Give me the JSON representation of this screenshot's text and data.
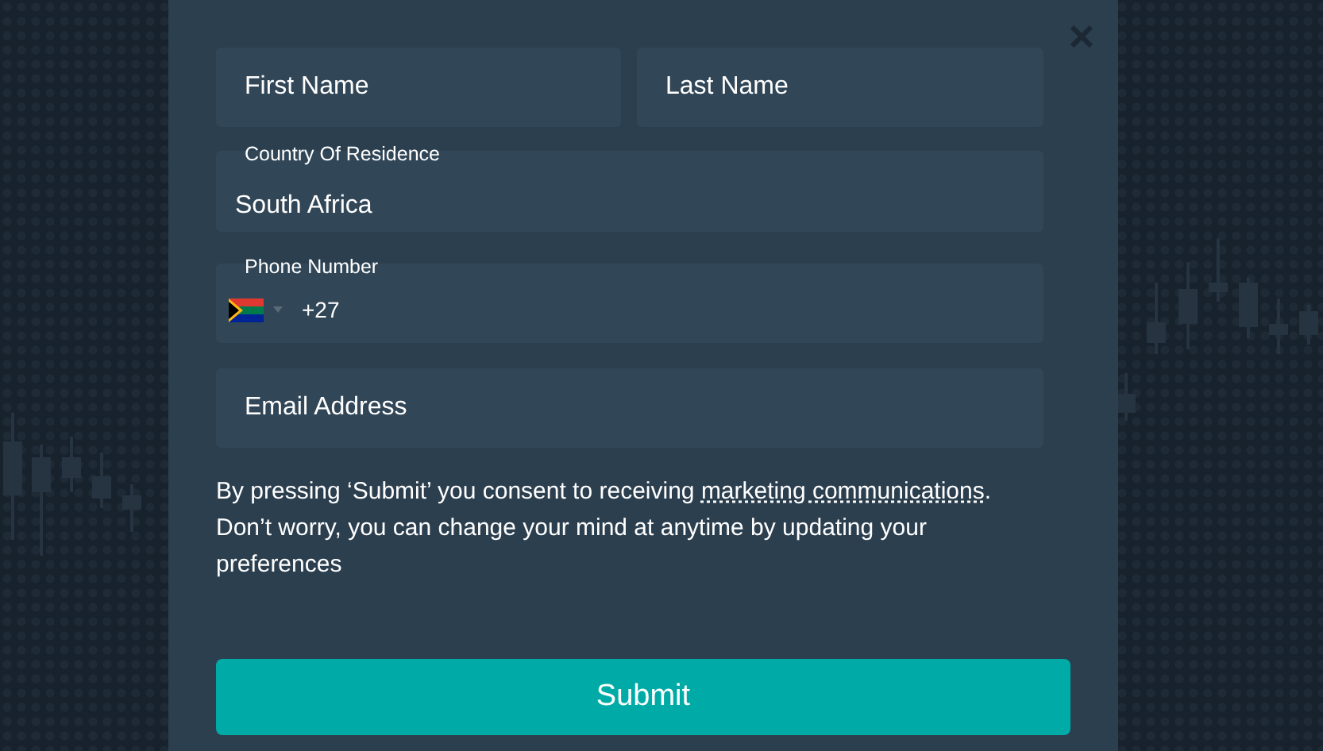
{
  "form": {
    "first_name": {
      "placeholder": "First Name"
    },
    "last_name": {
      "placeholder": "Last Name"
    },
    "country": {
      "label": "Country Of Residence",
      "value": "South Africa"
    },
    "phone": {
      "label": "Phone Number",
      "value": "+27"
    },
    "email": {
      "placeholder": "Email Address"
    },
    "consent": {
      "before": "By pressing ‘Submit’ you consent to receiving ",
      "link": "marketing communications",
      "after": ". Don’t worry, you can change your mind at anytime by updating your preferences"
    },
    "submit": "Submit"
  }
}
